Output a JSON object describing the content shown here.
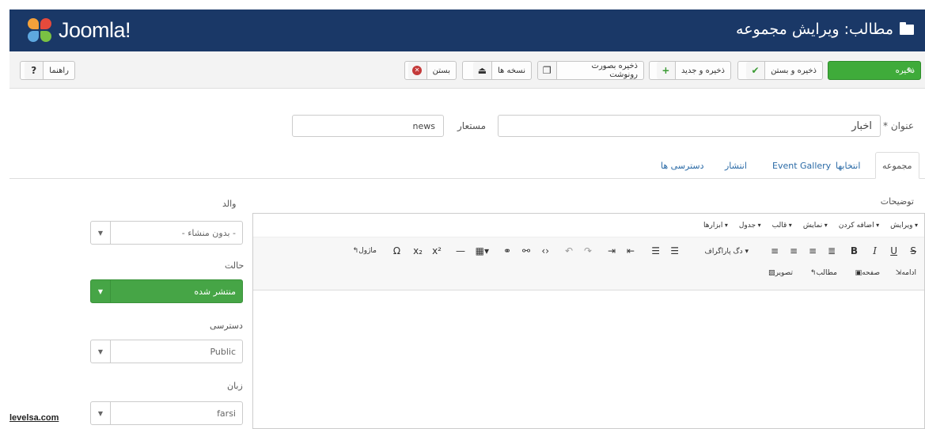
{
  "header": {
    "logo_text": "Joomla!",
    "title": "مطالب: ویرایش مجموعه",
    "bg_color": "#1a3867"
  },
  "toolbar": {
    "save_label": "ذخیره",
    "save_close_label": "ذخیره و بستن",
    "save_new_label": "ذخیره و جدید",
    "save_copy_label": "ذخیره بصورت رونوشت",
    "versions_label": "نسخه ها",
    "close_label": "بستن",
    "help_label": "راهنما",
    "accent_color": "#3fab3a"
  },
  "form": {
    "title_label": "عنوان *",
    "title_value": "اخبار",
    "alias_label": "مستعار",
    "alias_value": "news"
  },
  "tabs": [
    {
      "label": "مجموعه"
    },
    {
      "label": "انتخابها"
    },
    {
      "label": "Event Gallery"
    },
    {
      "label": "انتشار"
    },
    {
      "label": "دسترسی ها"
    }
  ],
  "editor": {
    "description_label": "توضیحات",
    "menus": [
      "ویرایش",
      "اضافه کردن",
      "نمایش",
      "قالب",
      "جدول",
      "ابزارها"
    ],
    "format_select": "دگ پاراگراف",
    "tools": {
      "readmore": "ادامه",
      "article": "مطالب",
      "image": "تصویر",
      "module": "ماژول",
      "pagebreak": "صفحه"
    }
  },
  "sidebar": {
    "parent_label": "والد",
    "parent_value": "- بدون منشاء -",
    "state_label": "حالت",
    "state_value": "منتشر شده",
    "access_label": "دسترسی",
    "access_value": "Public",
    "language_label": "زبان",
    "language_value": "farsi"
  },
  "watermark": "levelsa.com"
}
